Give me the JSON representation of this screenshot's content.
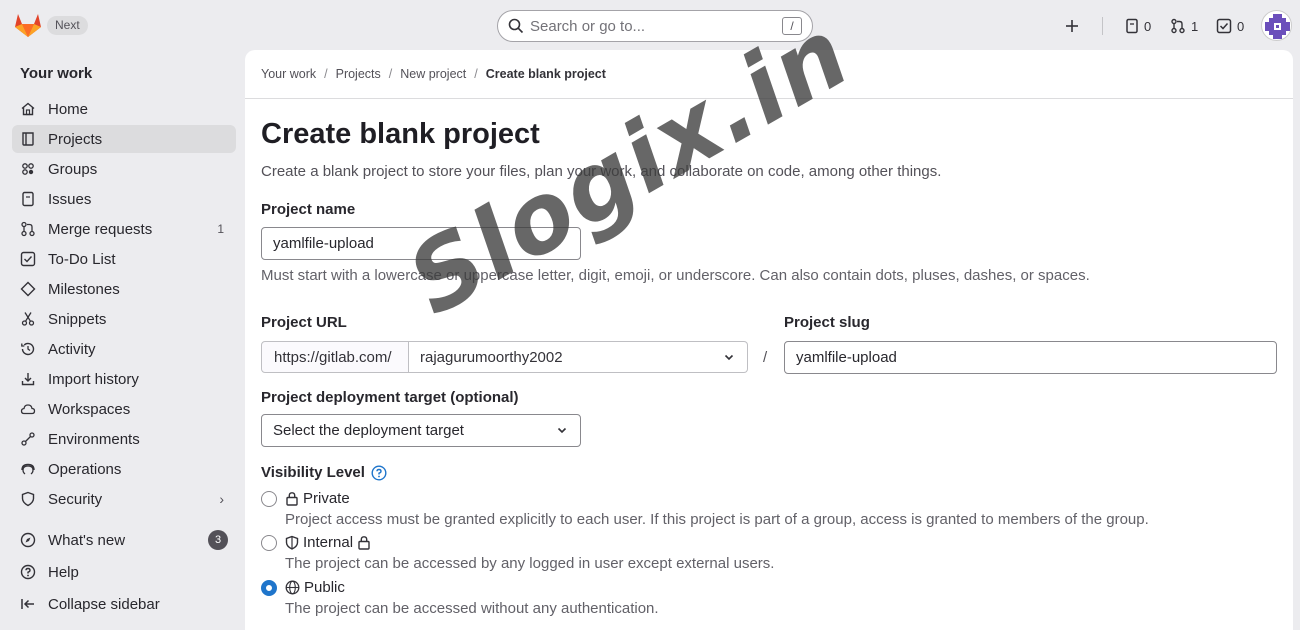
{
  "topbar": {
    "next_label": "Next",
    "search_placeholder": "Search or go to...",
    "search_shortcut": "/",
    "issues_count": "0",
    "merge_requests_count": "1",
    "todos_count": "0"
  },
  "sidebar": {
    "heading": "Your work",
    "items": [
      {
        "label": "Home",
        "icon": "home-icon"
      },
      {
        "label": "Projects",
        "icon": "project-icon",
        "active": true
      },
      {
        "label": "Groups",
        "icon": "group-icon"
      },
      {
        "label": "Issues",
        "icon": "issues-icon"
      },
      {
        "label": "Merge requests",
        "icon": "merge-request-icon",
        "count": "1"
      },
      {
        "label": "To-Do List",
        "icon": "todo-icon"
      },
      {
        "label": "Milestones",
        "icon": "milestone-icon"
      },
      {
        "label": "Snippets",
        "icon": "snippet-icon"
      },
      {
        "label": "Activity",
        "icon": "history-icon"
      },
      {
        "label": "Import history",
        "icon": "import-icon"
      },
      {
        "label": "Workspaces",
        "icon": "workspace-icon"
      },
      {
        "label": "Environments",
        "icon": "environment-icon"
      },
      {
        "label": "Operations",
        "icon": "operations-icon"
      },
      {
        "label": "Security",
        "icon": "shield-icon"
      }
    ],
    "whats_new_label": "What's new",
    "whats_new_count": "3",
    "help_label": "Help",
    "collapse_label": "Collapse sidebar"
  },
  "breadcrumbs": [
    "Your work",
    "Projects",
    "New project",
    "Create blank project"
  ],
  "page": {
    "title": "Create blank project",
    "description": "Create a blank project to store your files, plan your work, and collaborate on code, among other things.",
    "project_name_label": "Project name",
    "project_name_value": "yamlfile-upload",
    "project_name_help": "Must start with a lowercase or uppercase letter, digit, emoji, or underscore. Can also contain dots, pluses, dashes, or spaces.",
    "project_url_label": "Project URL",
    "url_prefix": "https://gitlab.com/",
    "namespace": "rajagurumoorthy2002",
    "url_separator": "/",
    "project_slug_label": "Project slug",
    "project_slug_value": "yamlfile-upload",
    "deployment_label": "Project deployment target (optional)",
    "deployment_placeholder": "Select the deployment target",
    "visibility_label": "Visibility Level",
    "visibility": [
      {
        "label": "Private",
        "description": "Project access must be granted explicitly to each user. If this project is part of a group, access is granted to members of the group.",
        "checked": false
      },
      {
        "label": "Internal",
        "description": "The project can be accessed by any logged in user except external users.",
        "checked": false
      },
      {
        "label": "Public",
        "description": "The project can be accessed without any authentication.",
        "checked": true
      }
    ]
  },
  "watermark": "Slogix.in",
  "colors": {
    "accent": "#1f75cb",
    "brand_orange": "#e24329",
    "background": "#ececef"
  }
}
